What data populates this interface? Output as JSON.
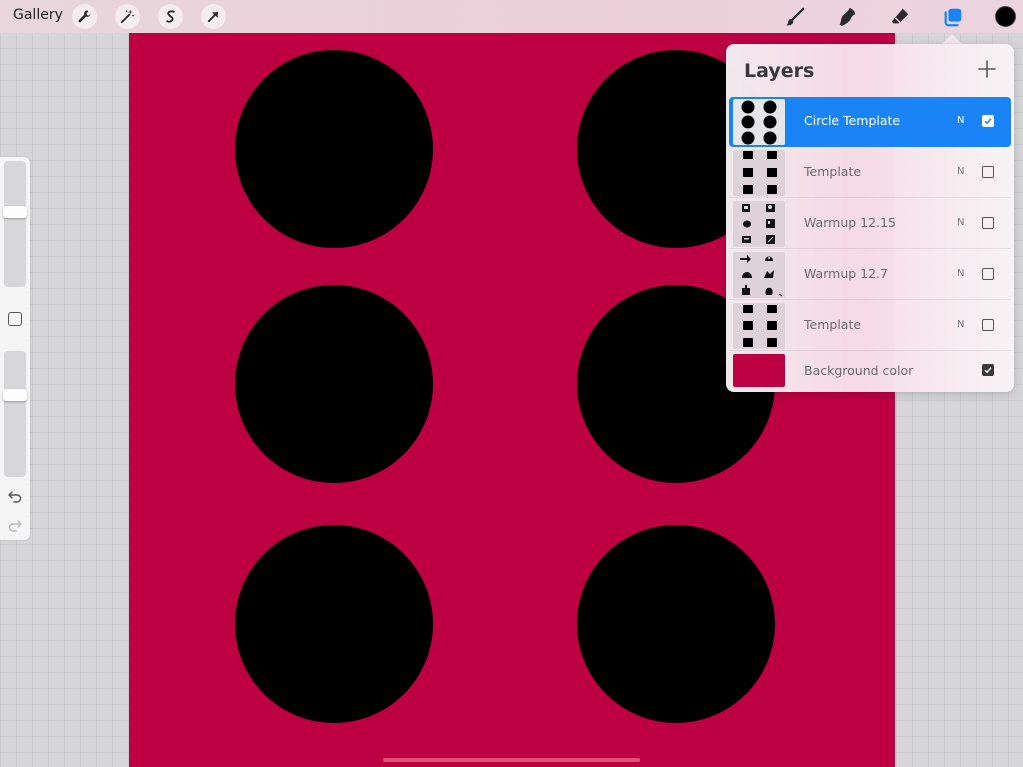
{
  "topbar": {
    "gallery_label": "Gallery",
    "left_tools": [
      "wrench-icon",
      "magic-wand-icon",
      "selection-icon",
      "transform-arrow-icon"
    ],
    "right_tools": [
      "brush-icon",
      "smudge-icon",
      "eraser-icon",
      "layers-icon"
    ],
    "active_color": "#000000"
  },
  "canvas": {
    "background_color": "#bd0042",
    "circle_color": "#000000",
    "circle_count": 6
  },
  "sidebar": {
    "brush_size_level": 0.35,
    "opacity_level": 0.35,
    "icons": [
      "modify-square-icon",
      "undo-icon",
      "redo-icon"
    ]
  },
  "layers": {
    "title": "Layers",
    "add_icon": "plus-icon",
    "items": [
      {
        "name": "Circle Template",
        "blend": "N",
        "visible": true,
        "active": true
      },
      {
        "name": "Template",
        "blend": "N",
        "visible": false,
        "active": false
      },
      {
        "name": "Warmup 12.15",
        "blend": "N",
        "visible": false,
        "active": false
      },
      {
        "name": "Warmup 12.7",
        "blend": "N",
        "visible": false,
        "active": false
      },
      {
        "name": "Template",
        "blend": "N",
        "visible": false,
        "active": false
      }
    ],
    "background": {
      "name": "Background color",
      "color": "#bd0042",
      "visible": true
    }
  },
  "accent_color": "#1a84f7"
}
